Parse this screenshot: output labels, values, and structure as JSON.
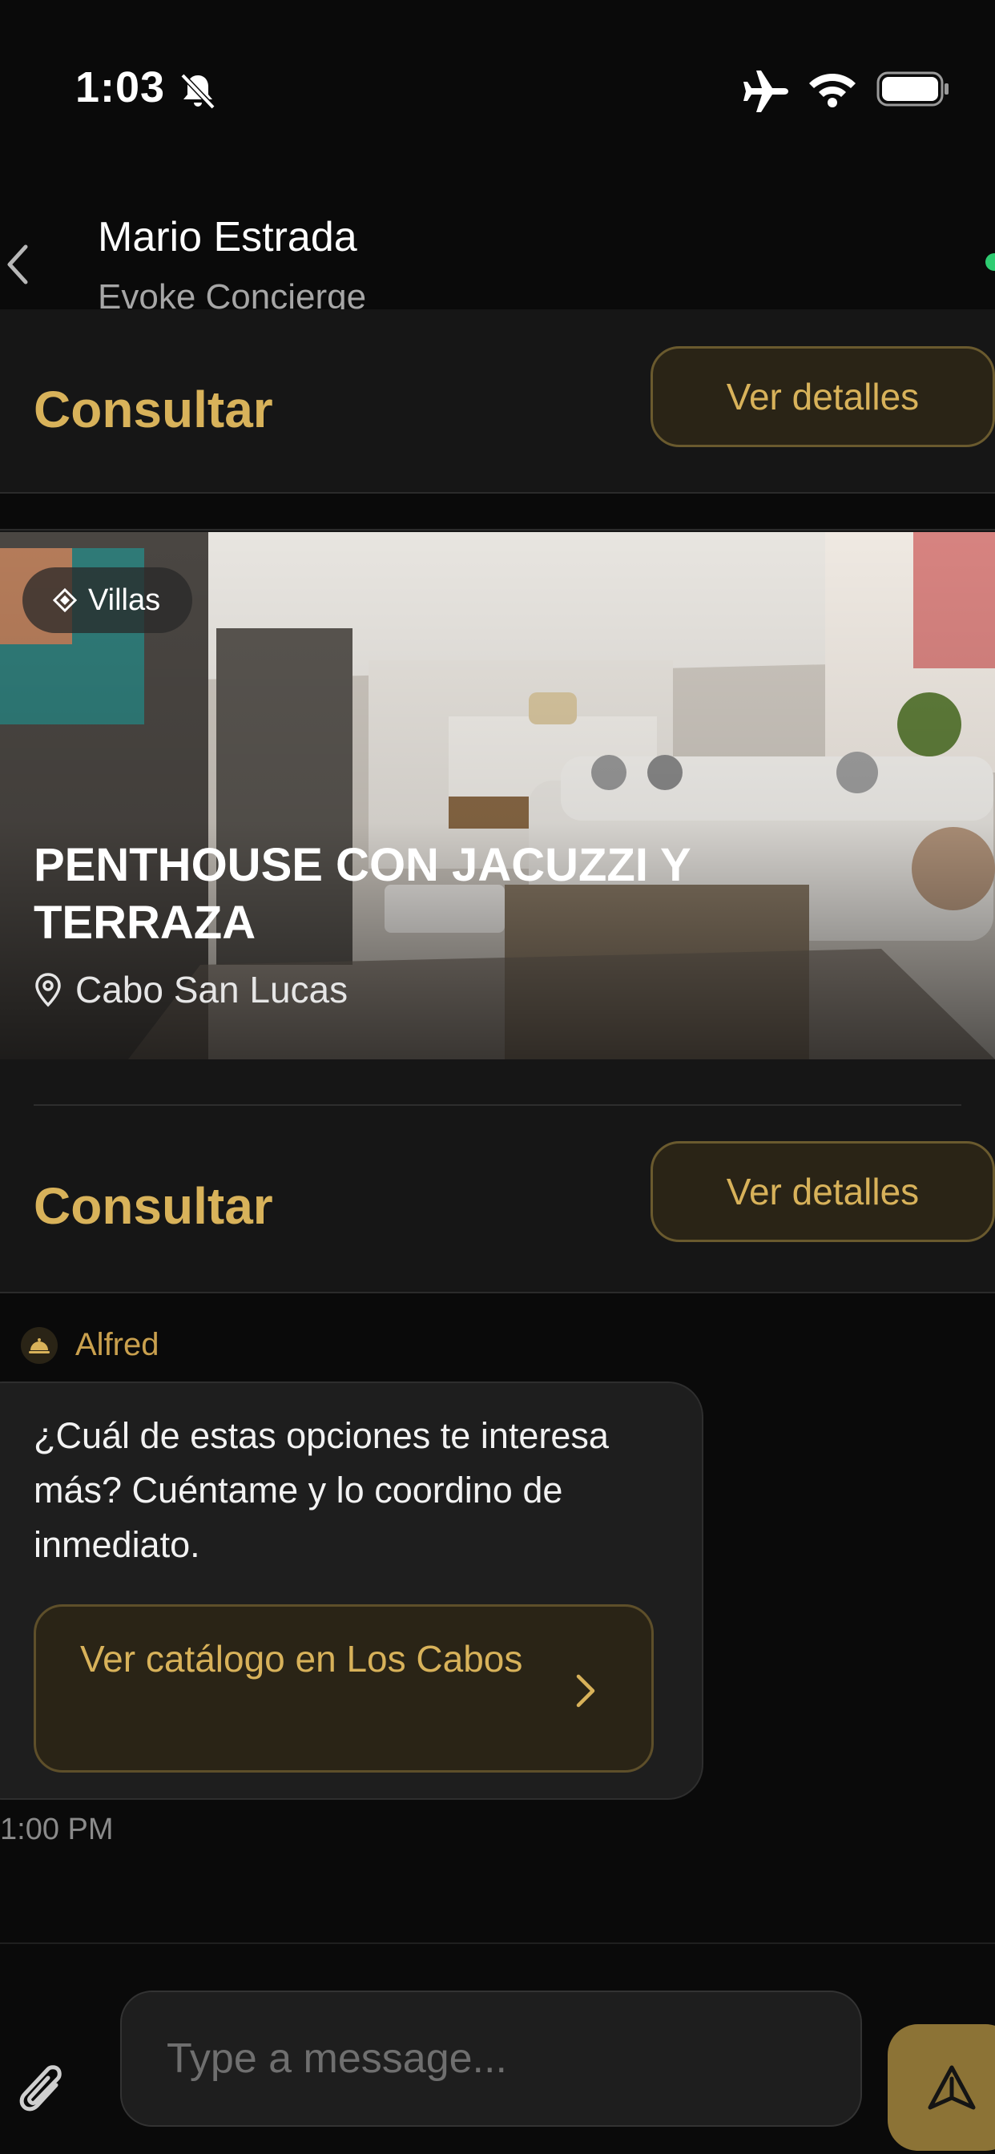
{
  "status_bar": {
    "time": "1:03",
    "icons": [
      "bell-slash-icon",
      "airplane-icon",
      "wifi-icon",
      "battery-icon"
    ]
  },
  "header": {
    "contact_name": "Mario Estrada",
    "contact_subtitle": "Evoke Concierge",
    "back_icon": "chevron-left-icon"
  },
  "cards": [
    {
      "consult_label": "Consultar",
      "details_label": "Ver detalles"
    },
    {
      "category": "Villas",
      "category_icon": "diamond-icon",
      "title": "PENTHOUSE CON JACUZZI Y TERRAZA",
      "location": "Cabo San Lucas",
      "location_icon": "map-pin-icon",
      "consult_label": "Consultar",
      "details_label": "Ver detalles"
    }
  ],
  "message": {
    "sender": "Alfred",
    "sender_icon": "concierge-bell-icon",
    "text": "¿Cuál de estas opciones te interesa más? Cuéntame y lo coordino de inmediato.",
    "action_label": "Ver catálogo en Los Cabos",
    "time": "1:00 PM"
  },
  "composer": {
    "placeholder": "Type a message...",
    "attach_icon": "paperclip-icon",
    "send_icon": "send-icon"
  },
  "colors": {
    "accent_gold": "#d8b25a",
    "background": "#0a0a0a",
    "card": "#161616",
    "online": "#2ecc71"
  }
}
